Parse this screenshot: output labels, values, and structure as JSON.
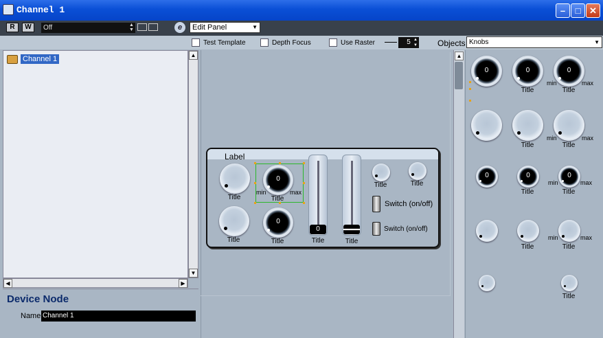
{
  "window": {
    "title": "Channel 1"
  },
  "toolbar": {
    "r_label": "R",
    "w_label": "W",
    "preset_value": "Off",
    "edit_mode": "Edit Panel"
  },
  "options": {
    "test_template": "Test Template",
    "depth_focus": "Depth Focus",
    "use_raster": "Use Raster",
    "raster_value": "5",
    "objects_label": "Objects",
    "objects_selected": "Knobs"
  },
  "tree": {
    "node_label": "Channel 1"
  },
  "device": {
    "heading": "Device Node",
    "name_label": "Name",
    "name_value": "Channel 1"
  },
  "panel": {
    "label": "Label",
    "knob_title": "Title",
    "knob_value": "0",
    "min_label": "min",
    "max_label": "max",
    "switch_label": "Switch (on/off)"
  },
  "objects_palette": {
    "title": "Title",
    "value": "0",
    "min": "min",
    "max": "max"
  },
  "colors": {
    "titlebar": "#0a4fd6",
    "selection": "#3167c5",
    "canvas": "#a9b6c4",
    "select_frame": "#2bb82b"
  }
}
